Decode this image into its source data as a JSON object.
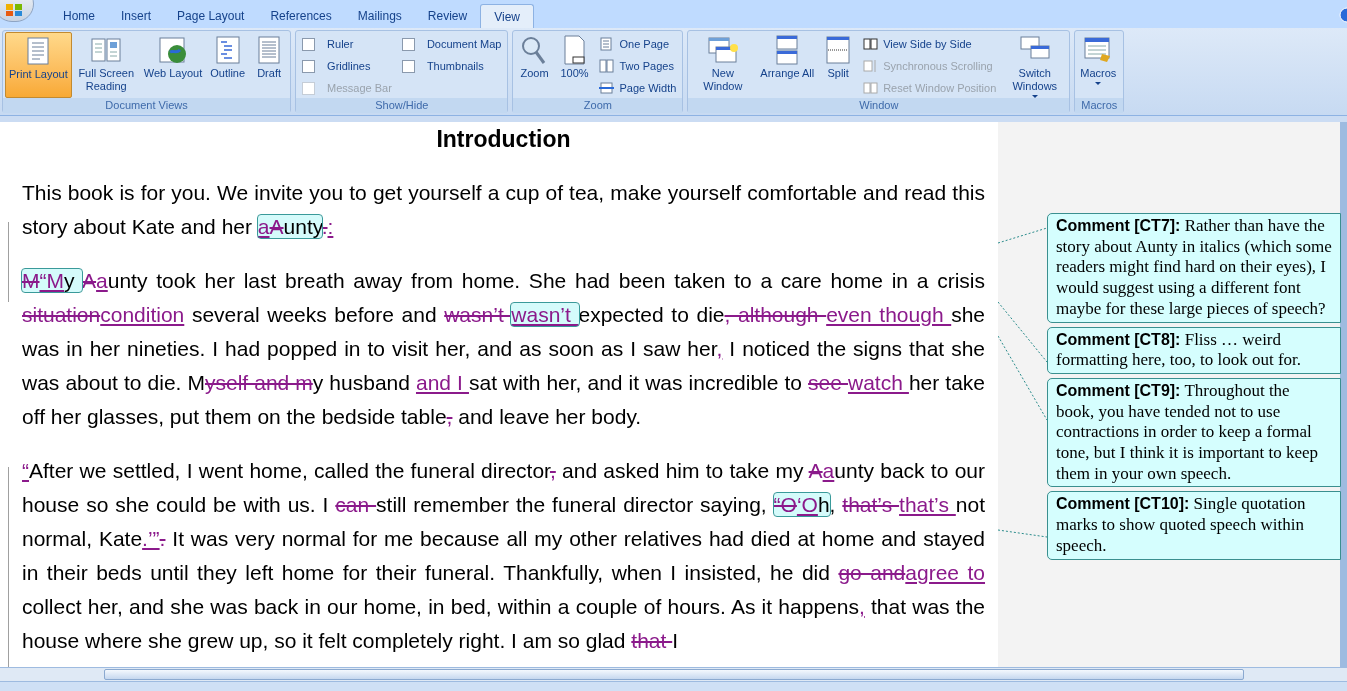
{
  "ribbon": {
    "tabs": [
      {
        "label": "Home",
        "selected": false
      },
      {
        "label": "Insert",
        "selected": false
      },
      {
        "label": "Page Layout",
        "selected": false
      },
      {
        "label": "References",
        "selected": false
      },
      {
        "label": "Mailings",
        "selected": false
      },
      {
        "label": "Review",
        "selected": false
      },
      {
        "label": "View",
        "selected": true
      }
    ],
    "groups": [
      {
        "label": "Document Views",
        "items": [
          {
            "kind": "big",
            "label": "Print Layout",
            "selected": true
          },
          {
            "kind": "big",
            "label": "Full Screen Reading",
            "selected": false
          },
          {
            "kind": "big",
            "label": "Web Layout",
            "selected": false
          },
          {
            "kind": "big",
            "label": "Outline",
            "selected": false
          },
          {
            "kind": "big",
            "label": "Draft",
            "selected": false
          }
        ]
      },
      {
        "label": "Show/Hide",
        "items": [
          {
            "kind": "check",
            "label": "Ruler",
            "checked": false,
            "disabled": false
          },
          {
            "kind": "check",
            "label": "Gridlines",
            "checked": false,
            "disabled": false
          },
          {
            "kind": "check",
            "label": "Message Bar",
            "checked": false,
            "disabled": true
          },
          {
            "kind": "check",
            "label": "Document Map",
            "checked": false,
            "disabled": false
          },
          {
            "kind": "check",
            "label": "Thumbnails",
            "checked": false,
            "disabled": false
          }
        ]
      },
      {
        "label": "Zoom",
        "items": [
          {
            "kind": "big",
            "label": "Zoom"
          },
          {
            "kind": "big",
            "label": "100%"
          },
          {
            "kind": "small",
            "label": "One Page",
            "disabled": false
          },
          {
            "kind": "small",
            "label": "Two Pages",
            "disabled": false
          },
          {
            "kind": "small",
            "label": "Page Width",
            "disabled": false
          }
        ]
      },
      {
        "label": "Window",
        "items": [
          {
            "kind": "big",
            "label": "New Window"
          },
          {
            "kind": "big",
            "label": "Arrange All"
          },
          {
            "kind": "big",
            "label": "Split"
          },
          {
            "kind": "small",
            "label": "View Side by Side",
            "disabled": false
          },
          {
            "kind": "small",
            "label": "Synchronous Scrolling",
            "disabled": true
          },
          {
            "kind": "small",
            "label": "Reset Window Position",
            "disabled": true
          },
          {
            "kind": "big",
            "label": "Switch Windows",
            "dropdown": true
          }
        ]
      },
      {
        "label": "Macros",
        "items": [
          {
            "kind": "big",
            "label": "Macros",
            "dropdown": true
          }
        ]
      }
    ]
  },
  "document": {
    "heading": "Introduction",
    "paragraphs": [
      [
        {
          "kind": "text",
          "text": "This book is for you. We invite you to get yourself a cup of tea, make yourself comfortable and read this story about Kate and her "
        },
        {
          "kind": "comment",
          "children": [
            {
              "kind": "ins",
              "text": "a"
            },
            {
              "kind": "del",
              "text": "A"
            },
            {
              "kind": "text",
              "text": "unty"
            }
          ]
        },
        {
          "kind": "del",
          "text": "."
        },
        {
          "kind": "ins",
          "text": ":"
        }
      ],
      [
        {
          "kind": "comment",
          "children": [
            {
              "kind": "del",
              "text": "M"
            },
            {
              "kind": "ins",
              "text": "“M"
            },
            {
              "kind": "text",
              "text": "y "
            }
          ]
        },
        {
          "kind": "del",
          "text": "A"
        },
        {
          "kind": "ins",
          "text": "a"
        },
        {
          "kind": "text",
          "text": "unty took her last breath away from home. She had been taken to a care home in a crisis "
        },
        {
          "kind": "del",
          "text": "situation"
        },
        {
          "kind": "ins",
          "text": "condition"
        },
        {
          "kind": "text",
          "text": " several weeks before and "
        },
        {
          "kind": "del",
          "text": "wasn’t "
        },
        {
          "kind": "comment",
          "children": [
            {
              "kind": "ins",
              "text": "wasn’t "
            }
          ]
        },
        {
          "kind": "text",
          "text": "expected to die"
        },
        {
          "kind": "del",
          "text": ", although "
        },
        {
          "kind": "ins",
          "text": "even though "
        },
        {
          "kind": "text",
          "text": "she was in her nineties. I had popped in to visit her, and as soon as I saw her"
        },
        {
          "kind": "ins",
          "text": ","
        },
        {
          "kind": "text",
          "text": " I noticed the signs that she was about to die. M"
        },
        {
          "kind": "del",
          "text": "yself and m"
        },
        {
          "kind": "text",
          "text": "y husband "
        },
        {
          "kind": "ins",
          "text": "and I "
        },
        {
          "kind": "text",
          "text": "sat with her, and it was incredible to "
        },
        {
          "kind": "del",
          "text": "see "
        },
        {
          "kind": "ins",
          "text": "watch "
        },
        {
          "kind": "text",
          "text": "her take off her glasses, put them on the bedside table"
        },
        {
          "kind": "del",
          "text": ","
        },
        {
          "kind": "text",
          "text": " and leave her body."
        }
      ],
      [
        {
          "kind": "ins",
          "text": "“"
        },
        {
          "kind": "text",
          "text": "After we settled, I went home, called the funeral director"
        },
        {
          "kind": "del",
          "text": ","
        },
        {
          "kind": "text",
          "text": " and asked him to take my "
        },
        {
          "kind": "del",
          "text": "A"
        },
        {
          "kind": "ins",
          "text": "a"
        },
        {
          "kind": "text",
          "text": "unty back to our house so she could be with us. I "
        },
        {
          "kind": "del",
          "text": "can "
        },
        {
          "kind": "text",
          "text": "still remember the funeral director saying, "
        },
        {
          "kind": "comment",
          "children": [
            {
              "kind": "del",
              "text": "“O"
            },
            {
              "kind": "ins",
              "text": "‘O"
            },
            {
              "kind": "text",
              "text": "h"
            }
          ]
        },
        {
          "kind": "text",
          "text": ", "
        },
        {
          "kind": "del",
          "text": "that’s "
        },
        {
          "kind": "ins",
          "text": "that’s "
        },
        {
          "kind": "text",
          "text": "not normal, Kate"
        },
        {
          "kind": "ins",
          "text": ".’”"
        },
        {
          "kind": "del",
          "text": "."
        },
        {
          "kind": "text",
          "text": " It was very normal for me because all my other relatives had died at home and stayed in their beds until they left home for their funeral. Thankfully, when I insisted, he did "
        },
        {
          "kind": "del",
          "text": "go and"
        },
        {
          "kind": "ins",
          "text": "agree to"
        },
        {
          "kind": "text",
          "text": " collect her, and she was back in our home, in bed, within a couple of hours. As it happens"
        },
        {
          "kind": "ins",
          "text": ","
        },
        {
          "kind": "text",
          "text": " that was the house where she grew up, so it felt completely right. I am so glad "
        },
        {
          "kind": "del",
          "text": "that "
        },
        {
          "kind": "text",
          "text": "I"
        }
      ]
    ]
  },
  "comments": [
    {
      "label": "Comment [CT7]:",
      "text": "Rather than have the story about Aunty in italics (which some readers might find hard on their eyes), I would suggest using a different font maybe for these large pieces of speech?"
    },
    {
      "label": "Comment [CT8]:",
      "text": "Fliss … weird formatting here, too, to look out for."
    },
    {
      "label": "Comment [CT9]:",
      "text": "Throughout the book, you have tended not to use contractions in order to keep a formal tone, but I think it is important to keep them in your own speech."
    },
    {
      "label": "Comment [CT10]:",
      "text": "Single quotation marks to show quoted speech within speech."
    }
  ]
}
